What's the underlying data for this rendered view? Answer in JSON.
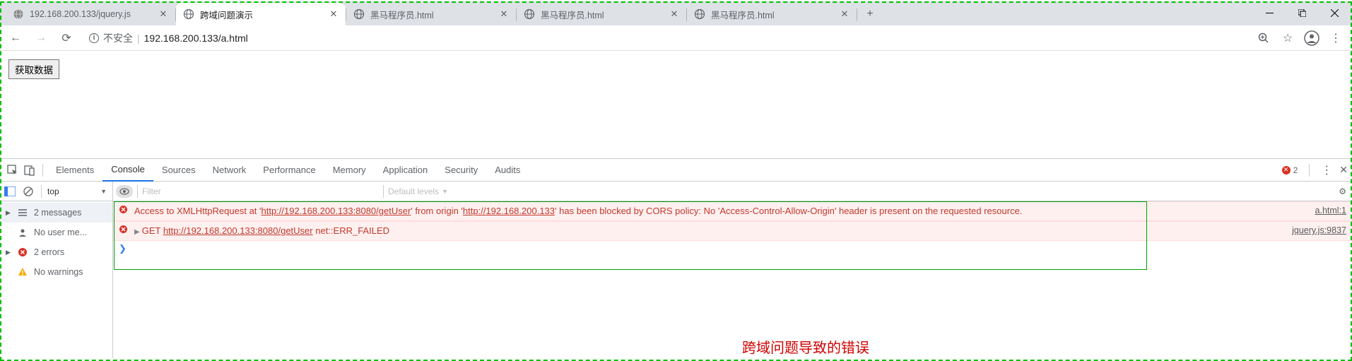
{
  "tabs": [
    {
      "title": "192.168.200.133/jquery.js",
      "favicon": "globe-gray"
    },
    {
      "title": "跨域问题演示",
      "favicon": "globe-line",
      "active": true
    },
    {
      "title": "黑马程序员.html",
      "favicon": "globe-line"
    },
    {
      "title": "黑马程序员.html",
      "favicon": "globe-line"
    },
    {
      "title": "黑马程序员.html",
      "favicon": "globe-line"
    }
  ],
  "addr": {
    "security_label": "不安全",
    "url": "192.168.200.133/a.html"
  },
  "page": {
    "button_label": "获取数据"
  },
  "devtools": {
    "tabs": [
      "Elements",
      "Console",
      "Sources",
      "Network",
      "Performance",
      "Memory",
      "Application",
      "Security",
      "Audits"
    ],
    "active_tab": "Console",
    "error_count": "2",
    "context": "top",
    "filter_placeholder": "Filter",
    "levels_label": "Default levels",
    "sidebar": [
      {
        "icon": "msg",
        "label": "2 messages",
        "expandable": true
      },
      {
        "icon": "user",
        "label": "No user me...",
        "expandable": false
      },
      {
        "icon": "error",
        "label": "2 errors",
        "expandable": true
      },
      {
        "icon": "warn",
        "label": "No warnings",
        "expandable": false
      }
    ],
    "console": [
      {
        "type": "error",
        "text_pre": "Access to XMLHttpRequest at '",
        "url1": "http://192.168.200.133:8080/getUser",
        "text_mid": "' from origin '",
        "url2": "http://192.168.200.133",
        "text_post": "' has been blocked by CORS policy: No 'Access-Control-Allow-Origin' header is present on the requested resource.",
        "source": "a.html:1"
      },
      {
        "type": "error",
        "expandable": true,
        "method": "GET",
        "url": "http://192.168.200.133:8080/getUser",
        "status": "net::ERR_FAILED",
        "source": "jquery.js:9837"
      }
    ],
    "annotation": "跨域问题导致的错误"
  }
}
